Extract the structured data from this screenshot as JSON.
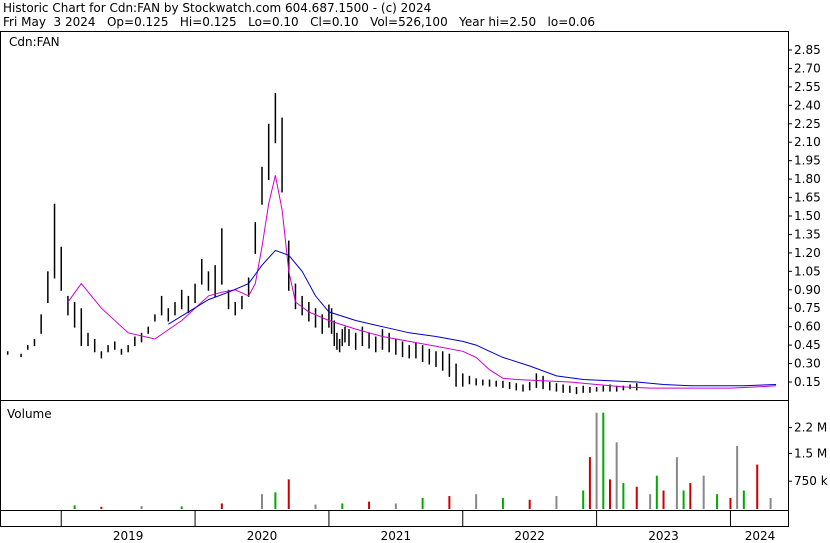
{
  "header": {
    "line1": "Historic Chart for Cdn:FAN by Stockwatch.com 604.687.1500 - (c) 2024",
    "line2": "Fri May  3 2024   Op=0.125   Hi=0.125   Lo=0.10   Cl=0.10   Vol=526,100   Year hi=2.50   lo=0.06"
  },
  "price_panel": {
    "symbol_label": "Cdn:FAN"
  },
  "volume_panel": {
    "label": "Volume"
  },
  "chart_data": [
    {
      "type": "line",
      "title": "Historic Chart for Cdn:FAN",
      "ylim": [
        0,
        3.0
      ],
      "y_ticks": [
        "2.85",
        "2.70",
        "2.55",
        "2.40",
        "2.25",
        "2.10",
        "1.95",
        "1.80",
        "1.65",
        "1.50",
        "1.35",
        "1.20",
        "1.05",
        "0.90",
        "0.75",
        "0.60",
        "0.45",
        "0.30",
        "0.15"
      ],
      "x_ticks": [
        "2019",
        "2020",
        "2021",
        "2022",
        "2023",
        "2024"
      ],
      "series": [
        {
          "type": "bar",
          "x": [
            2018.5,
            2018.6,
            2018.7,
            2018.75,
            2018.8,
            2018.85,
            2018.9,
            2018.95,
            2019.0,
            2019.05,
            2019.1,
            2019.15,
            2019.2,
            2019.25,
            2019.3,
            2019.35,
            2019.4,
            2019.45,
            2019.5,
            2019.55,
            2019.6,
            2019.65,
            2019.7,
            2019.75,
            2019.8,
            2019.85,
            2019.9,
            2019.95,
            2020.0,
            2020.05,
            2020.1,
            2020.15,
            2020.2,
            2020.25,
            2020.3,
            2020.35,
            2020.4,
            2020.45,
            2020.5,
            2020.55,
            2020.6,
            2020.65,
            2020.7,
            2020.75,
            2020.8,
            2020.85,
            2020.9,
            2020.95,
            2021.0,
            2021.02,
            2021.04,
            2021.06,
            2021.08,
            2021.1,
            2021.12,
            2021.15,
            2021.2,
            2021.25,
            2021.3,
            2021.35,
            2021.4,
            2021.45,
            2021.5,
            2021.55,
            2021.6,
            2021.65,
            2021.7,
            2021.75,
            2021.8,
            2021.85,
            2021.9,
            2021.95,
            2022.0,
            2022.05,
            2022.1,
            2022.15,
            2022.2,
            2022.25,
            2022.3,
            2022.35,
            2022.4,
            2022.45,
            2022.5,
            2022.55,
            2022.6,
            2022.65,
            2022.7,
            2022.75,
            2022.8,
            2022.85,
            2022.9,
            2022.95,
            2023.0,
            2023.05,
            2023.1,
            2023.15,
            2023.2,
            2023.25,
            2023.3,
            2023.35,
            2023.4,
            2023.45,
            2023.5,
            2023.55,
            2023.6,
            2023.65,
            2023.7,
            2023.75,
            2023.8,
            2023.85,
            2023.9,
            2023.95,
            2024.0,
            2024.05,
            2024.1,
            2024.15,
            2024.2,
            2024.25,
            2024.3,
            2024.34
          ],
          "high": [
            0.42,
            0.4,
            0.38,
            0.45,
            0.5,
            0.7,
            1.05,
            1.6,
            1.25,
            0.85,
            0.8,
            0.75,
            0.55,
            0.5,
            0.4,
            0.45,
            0.48,
            0.42,
            0.45,
            0.52,
            0.55,
            0.6,
            0.7,
            0.85,
            0.75,
            0.8,
            0.9,
            0.85,
            0.95,
            1.15,
            1.05,
            1.1,
            1.4,
            0.9,
            0.8,
            0.85,
            1.0,
            1.45,
            1.9,
            2.25,
            2.5,
            2.3,
            1.3,
            0.95,
            0.85,
            0.8,
            0.75,
            0.7,
            0.78,
            0.75,
            0.65,
            0.55,
            0.5,
            0.58,
            0.6,
            0.58,
            0.55,
            0.6,
            0.55,
            0.52,
            0.58,
            0.55,
            0.5,
            0.48,
            0.45,
            0.47,
            0.45,
            0.42,
            0.4,
            0.4,
            0.38,
            0.3,
            0.22,
            0.2,
            0.18,
            0.17,
            0.17,
            0.16,
            0.16,
            0.15,
            0.14,
            0.13,
            0.15,
            0.22,
            0.2,
            0.15,
            0.14,
            0.13,
            0.12,
            0.11,
            0.12,
            0.11,
            0.11,
            0.12,
            0.13,
            0.12,
            0.12,
            0.13,
            0.14
          ],
          "low": [
            0.4,
            0.38,
            0.36,
            0.42,
            0.45,
            0.55,
            0.8,
            1.0,
            0.9,
            0.7,
            0.6,
            0.45,
            0.45,
            0.4,
            0.35,
            0.4,
            0.42,
            0.38,
            0.4,
            0.45,
            0.48,
            0.55,
            0.65,
            0.7,
            0.65,
            0.7,
            0.75,
            0.72,
            0.8,
            0.95,
            0.9,
            0.85,
            0.95,
            0.75,
            0.7,
            0.75,
            0.85,
            1.2,
            1.6,
            1.8,
            2.1,
            1.7,
            0.9,
            0.75,
            0.7,
            0.65,
            0.6,
            0.55,
            0.6,
            0.55,
            0.45,
            0.42,
            0.4,
            0.45,
            0.48,
            0.45,
            0.42,
            0.45,
            0.43,
            0.4,
            0.42,
            0.4,
            0.38,
            0.36,
            0.35,
            0.35,
            0.32,
            0.3,
            0.28,
            0.25,
            0.2,
            0.12,
            0.12,
            0.14,
            0.13,
            0.13,
            0.12,
            0.12,
            0.11,
            0.1,
            0.09,
            0.08,
            0.09,
            0.11,
            0.1,
            0.09,
            0.08,
            0.07,
            0.07,
            0.06,
            0.07,
            0.07,
            0.08,
            0.08,
            0.08,
            0.08,
            0.09,
            0.1,
            0.09
          ]
        },
        {
          "name": "",
          "color": "#cc00cc",
          "x": [
            2019.05,
            2019.15,
            2019.3,
            2019.5,
            2019.7,
            2019.9,
            2020.0,
            2020.1,
            2020.2,
            2020.3,
            2020.4,
            2020.45,
            2020.5,
            2020.55,
            2020.6,
            2020.65,
            2020.7,
            2020.75,
            2020.85,
            2021.0,
            2021.2,
            2021.4,
            2021.6,
            2021.8,
            2022.0,
            2022.1,
            2022.2,
            2022.3,
            2022.4,
            2022.6,
            2022.8,
            2023.0,
            2023.2,
            2023.4,
            2023.6,
            2023.8,
            2024.0,
            2024.2,
            2024.34
          ],
          "y": [
            0.8,
            0.95,
            0.75,
            0.55,
            0.5,
            0.65,
            0.75,
            0.85,
            0.88,
            0.9,
            0.85,
            0.95,
            1.25,
            1.6,
            1.83,
            1.55,
            1.05,
            0.8,
            0.72,
            0.65,
            0.58,
            0.52,
            0.48,
            0.44,
            0.4,
            0.35,
            0.25,
            0.18,
            0.17,
            0.16,
            0.15,
            0.13,
            0.11,
            0.1,
            0.1,
            0.1,
            0.1,
            0.11,
            0.12
          ]
        },
        {
          "name": "",
          "color": "#0000cc",
          "x": [
            2019.8,
            2019.95,
            2020.1,
            2020.25,
            2020.4,
            2020.5,
            2020.6,
            2020.7,
            2020.8,
            2020.9,
            2021.0,
            2021.2,
            2021.4,
            2021.6,
            2021.8,
            2022.0,
            2022.1,
            2022.2,
            2022.3,
            2022.5,
            2022.7,
            2022.9,
            2023.1,
            2023.3,
            2023.5,
            2023.7,
            2023.9,
            2024.1,
            2024.34
          ],
          "y": [
            0.62,
            0.72,
            0.82,
            0.88,
            0.95,
            1.1,
            1.22,
            1.18,
            1.05,
            0.85,
            0.72,
            0.65,
            0.6,
            0.55,
            0.52,
            0.48,
            0.45,
            0.4,
            0.35,
            0.28,
            0.2,
            0.17,
            0.16,
            0.15,
            0.13,
            0.12,
            0.12,
            0.12,
            0.13
          ]
        }
      ]
    },
    {
      "type": "bar",
      "title": "Volume",
      "ylim": [
        0,
        2700000
      ],
      "y_ticks": [
        "2.2 M",
        "1.5 M",
        "750 k"
      ],
      "x": [
        2019.1,
        2019.3,
        2019.6,
        2019.9,
        2020.2,
        2020.5,
        2020.6,
        2020.7,
        2020.9,
        2021.1,
        2021.3,
        2021.5,
        2021.7,
        2021.9,
        2022.1,
        2022.3,
        2022.5,
        2022.7,
        2022.9,
        2022.95,
        2023.0,
        2023.05,
        2023.1,
        2023.15,
        2023.2,
        2023.3,
        2023.4,
        2023.45,
        2023.5,
        2023.6,
        2023.65,
        2023.7,
        2023.8,
        2023.9,
        2024.0,
        2024.05,
        2024.1,
        2024.2,
        2024.3
      ],
      "values": [
        100000,
        60000,
        80000,
        70000,
        150000,
        400000,
        450000,
        800000,
        120000,
        150000,
        200000,
        150000,
        300000,
        350000,
        400000,
        300000,
        250000,
        350000,
        500000,
        1400000,
        2600000,
        2600000,
        800000,
        1800000,
        700000,
        600000,
        400000,
        900000,
        500000,
        1400000,
        500000,
        700000,
        900000,
        400000,
        300000,
        1700000,
        500000,
        1200000,
        300000
      ]
    }
  ]
}
